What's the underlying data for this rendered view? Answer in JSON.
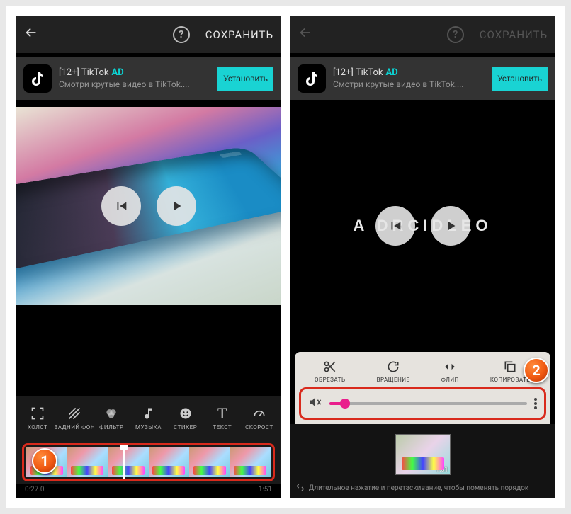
{
  "left": {
    "topbar": {
      "save": "СОХРАНИТЬ"
    },
    "ad": {
      "title": "[12+] TikTok",
      "badge": "AD",
      "subtitle": "Смотри крутые видео в TikTok....",
      "install": "Установить"
    },
    "tools": [
      {
        "icon": "crop",
        "label": "ХОЛСТ"
      },
      {
        "icon": "bg",
        "label": "ЗАДНИЙ ФОН"
      },
      {
        "icon": "filter",
        "label": "ФИЛЬТР"
      },
      {
        "icon": "music",
        "label": "МУЗЫКА"
      },
      {
        "icon": "sticker",
        "label": "СТИКЕР"
      },
      {
        "icon": "text",
        "label": "ТЕКСТ"
      },
      {
        "icon": "speed",
        "label": "СКОРОСТ"
      }
    ],
    "time": {
      "start": "0:27.0",
      "end": "1:51"
    }
  },
  "right": {
    "topbar": {
      "save": "СОХРАНИТЬ"
    },
    "ad": {
      "title": "[12+] TikTok",
      "badge": "AD",
      "subtitle": "Смотри крутые видео в TikTok....",
      "install": "Установить"
    },
    "brand": "A   DRCIDLEO",
    "tools2": [
      {
        "icon": "cut",
        "label": "ОБРЕЗАТЬ"
      },
      {
        "icon": "rotate",
        "label": "ВРАЩЕНИЕ"
      },
      {
        "icon": "flip",
        "label": "ФЛИП"
      },
      {
        "icon": "copy",
        "label": "КОПИРОВАТЬ"
      }
    ],
    "clip_duration": "1:51",
    "hint": "Длительное нажатие и перетаскивание, чтобы поменять порядок"
  },
  "callouts": {
    "one": "1",
    "two": "2"
  }
}
